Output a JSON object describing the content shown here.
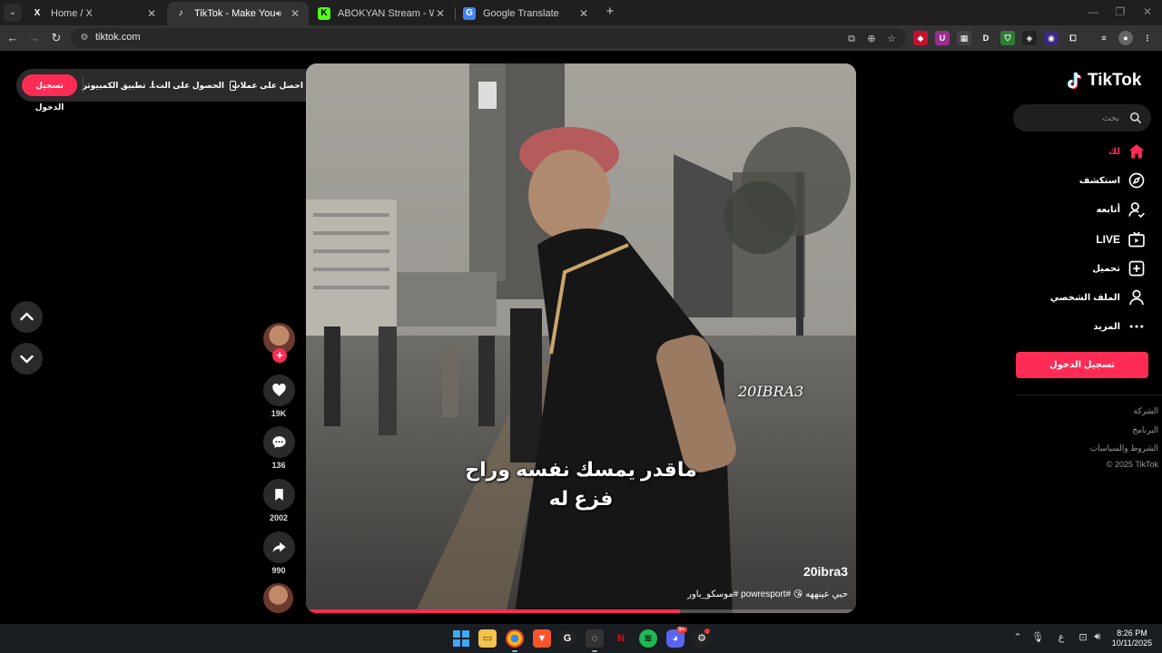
{
  "browser": {
    "tabs": [
      {
        "title": "Home / X",
        "favicon": "X",
        "active": false,
        "audio": false
      },
      {
        "title": "TikTok - Make Your Day",
        "favicon": "♪",
        "active": true,
        "audio": true
      },
      {
        "title": "ABOKYAN Stream - Watch Live",
        "favicon": "K",
        "active": false,
        "audio": false
      },
      {
        "title": "Google Translate",
        "favicon": "G",
        "active": false,
        "audio": false
      }
    ],
    "url": "tiktok.com"
  },
  "topbar": {
    "coins": "احصل على عملات",
    "get_app": "الحصول على الت...",
    "desktop_app": "تطبيق الكمبيوتر",
    "login": "تسجيل الدخول"
  },
  "video": {
    "watermark": "20IBRA3",
    "subtitle_line1": "ماقدر يمسك نفسه وراح",
    "subtitle_line2": "فزع له",
    "author": "20ibra3",
    "caption": "حبي عينههه 😘 #powresport #موسكو_باور",
    "progress": 0.68
  },
  "actions": {
    "likes": "19K",
    "comments": "136",
    "saves": "2002",
    "shares": "990"
  },
  "sidebar": {
    "logo": "TikTok",
    "search_placeholder": "بحث",
    "nav": [
      {
        "label": "لك",
        "icon": "home-icon",
        "active": true
      },
      {
        "label": "استكشف",
        "icon": "compass-icon",
        "active": false
      },
      {
        "label": "أتابعه",
        "icon": "following-icon",
        "active": false
      },
      {
        "label": "LIVE",
        "icon": "live-icon",
        "active": false
      },
      {
        "label": "تحميل",
        "icon": "upload-icon",
        "active": false
      },
      {
        "label": "الملف الشخصي",
        "icon": "profile-icon",
        "active": false
      },
      {
        "label": "المزيد",
        "icon": "more-icon",
        "active": false
      }
    ],
    "login": "تسجيل الدخول",
    "footer": [
      "الشركة",
      "البرنامج",
      "الشروط والسياسات",
      "© 2025 TikTok"
    ]
  },
  "taskbar": {
    "time": "8:26 PM",
    "date": "10/11/2025",
    "lang": "ع",
    "discord_badge": "9+"
  },
  "colors": {
    "accent": "#fe2c55"
  }
}
